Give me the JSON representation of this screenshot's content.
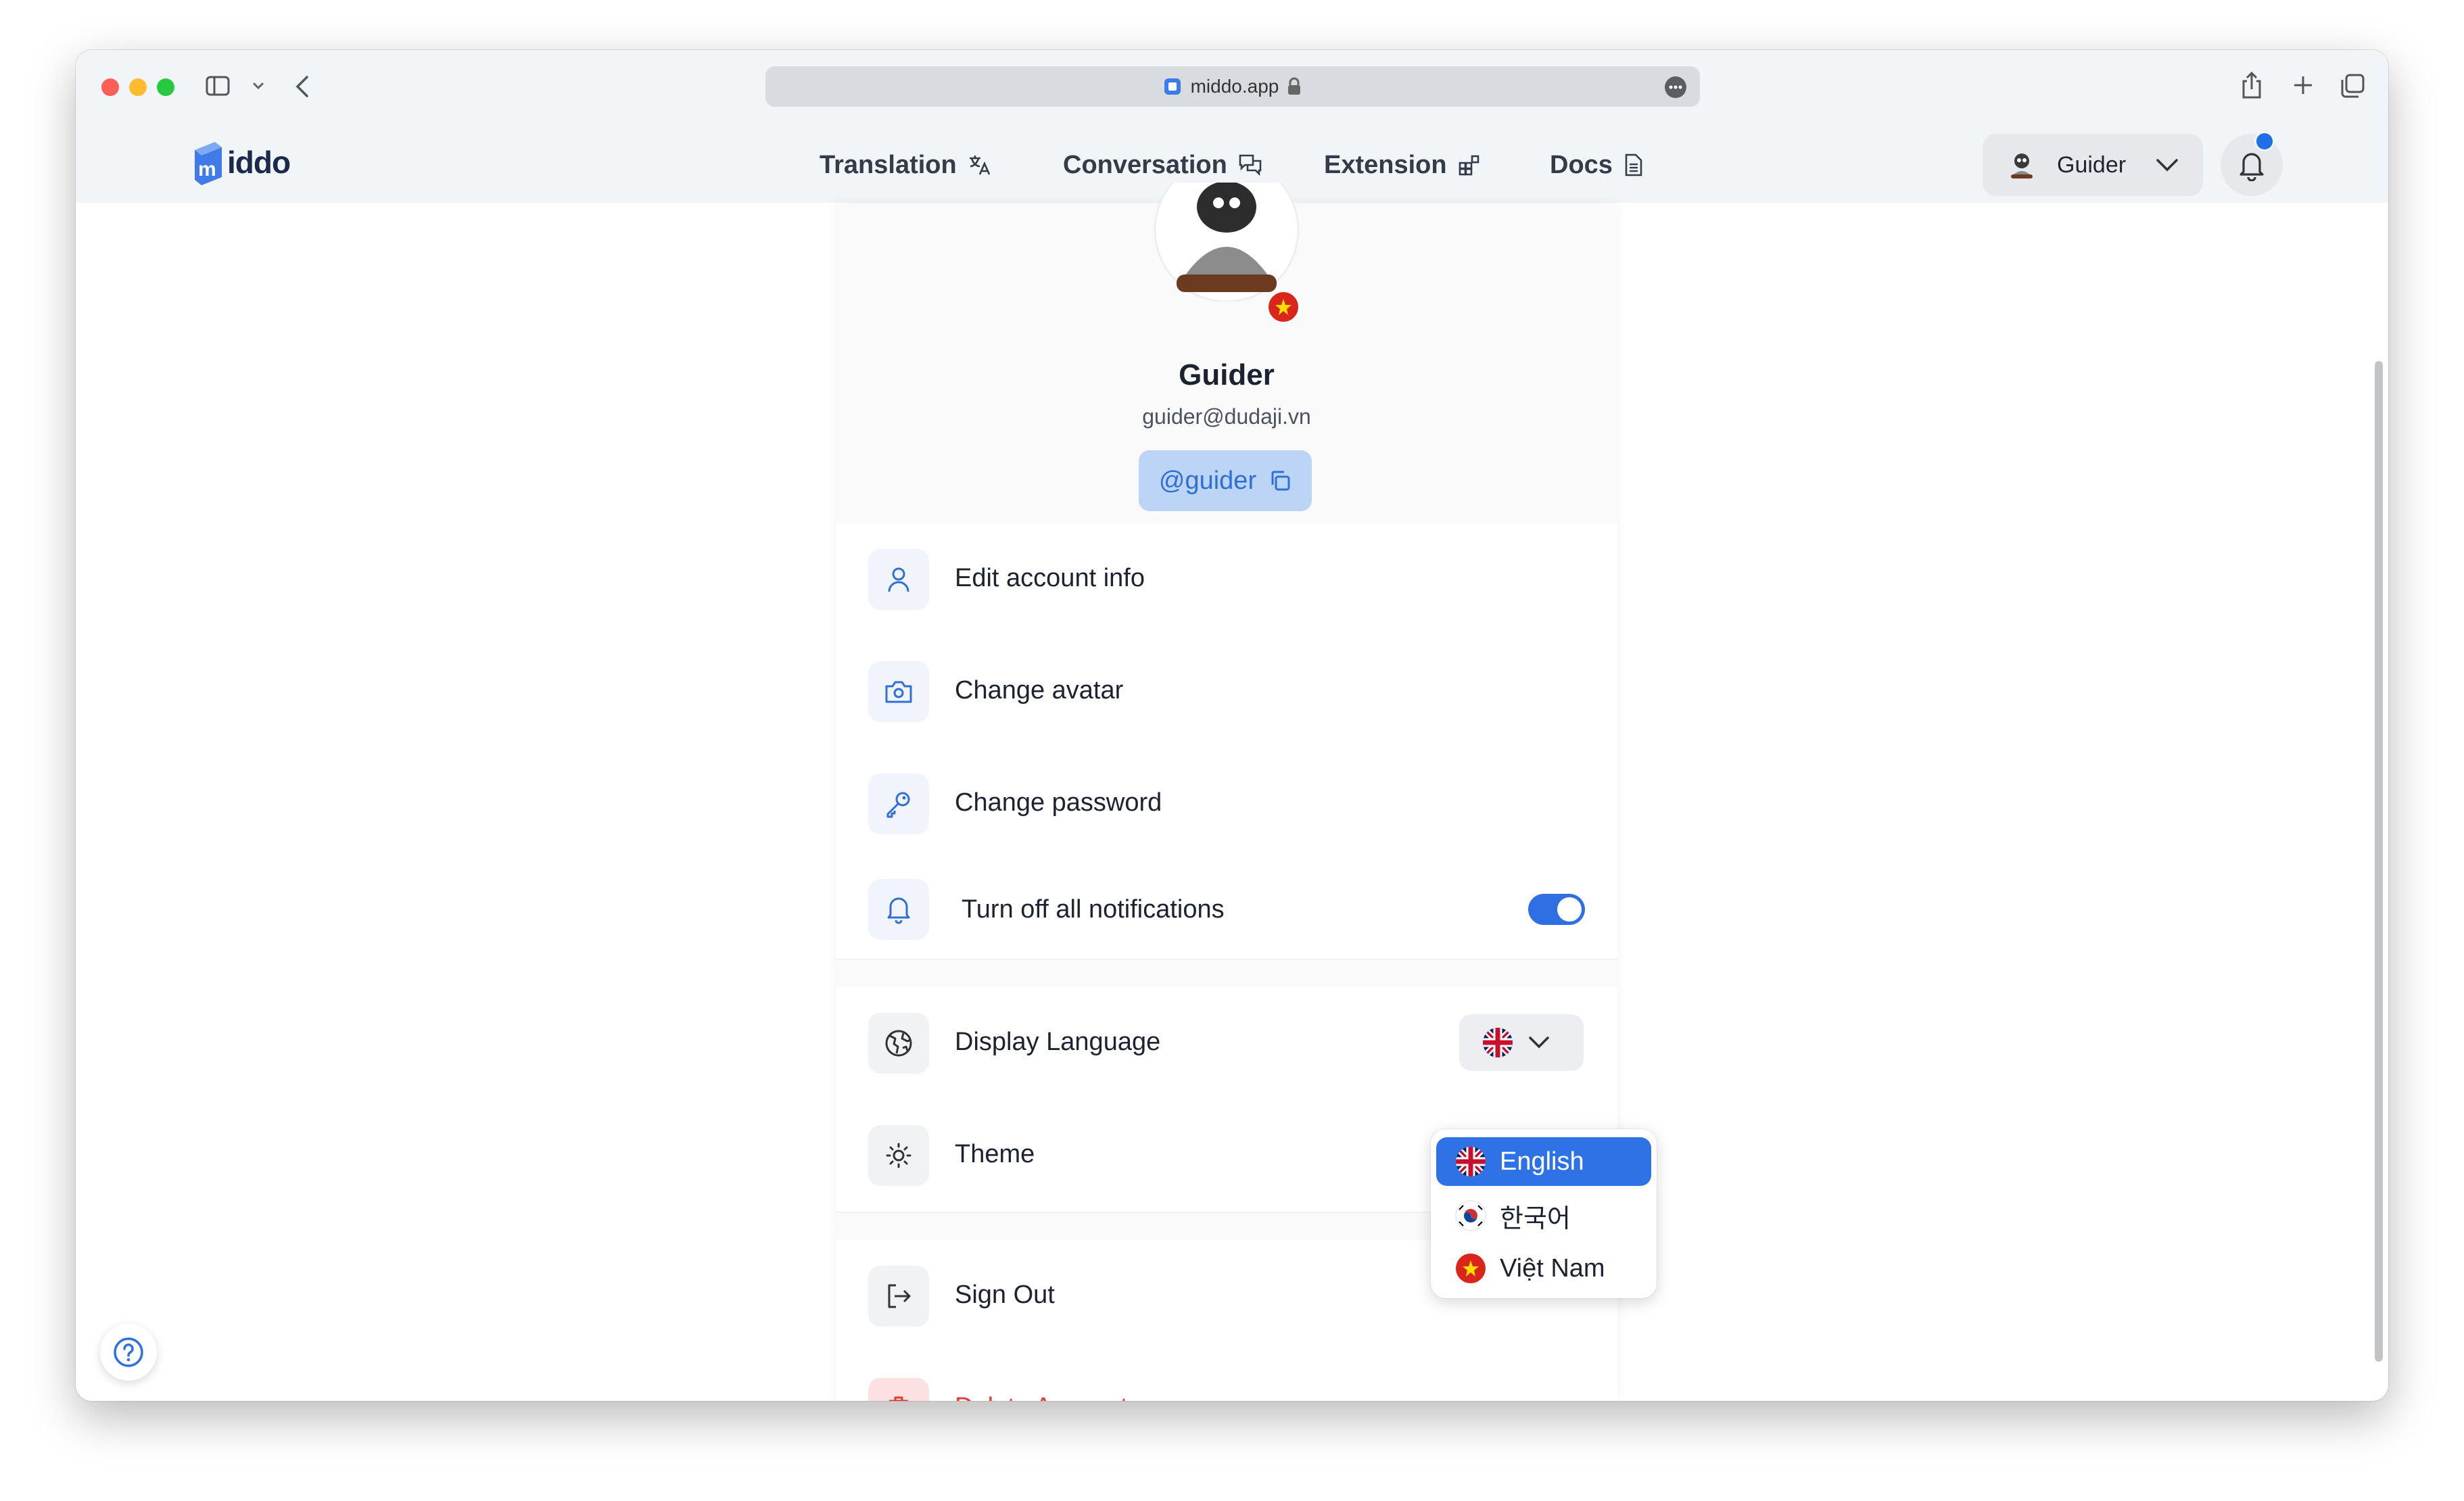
{
  "browser": {
    "address": "middo.app"
  },
  "app": {
    "logo_text": "iddo",
    "logo_letter": "m"
  },
  "nav": {
    "items": [
      {
        "label": "Translation"
      },
      {
        "label": "Conversation"
      },
      {
        "label": "Extension"
      },
      {
        "label": "Docs"
      }
    ]
  },
  "user_menu": {
    "name": "Guider"
  },
  "profile": {
    "name": "Guider",
    "email": "guider@dudaji.vn",
    "username": "@guider"
  },
  "menu": {
    "items": [
      {
        "label": "Edit account info",
        "icon": "user-icon"
      },
      {
        "label": "Change avatar",
        "icon": "camera-icon"
      },
      {
        "label": "Change password",
        "icon": "key-icon"
      },
      {
        "label": "Turn off all notifications",
        "icon": "bell-icon",
        "toggle_on": true
      },
      {
        "label": "Display Language",
        "icon": "globe-icon"
      },
      {
        "label": "Theme",
        "icon": "sun-icon"
      },
      {
        "label": "Sign Out",
        "icon": "logout-icon"
      },
      {
        "label": "Delete Account",
        "icon": "trash-icon"
      }
    ]
  },
  "language_dropdown": {
    "options": [
      {
        "label": "English",
        "flag": "uk-flag-icon",
        "selected": true
      },
      {
        "label": "한국어",
        "flag": "kr-flag-icon",
        "selected": false
      },
      {
        "label": "Việt Nam",
        "flag": "vn-flag-icon",
        "selected": false
      }
    ]
  },
  "colors": {
    "accent": "#2f6fe4",
    "danger": "#e53935",
    "chip_bg": "#bcd5f7"
  }
}
